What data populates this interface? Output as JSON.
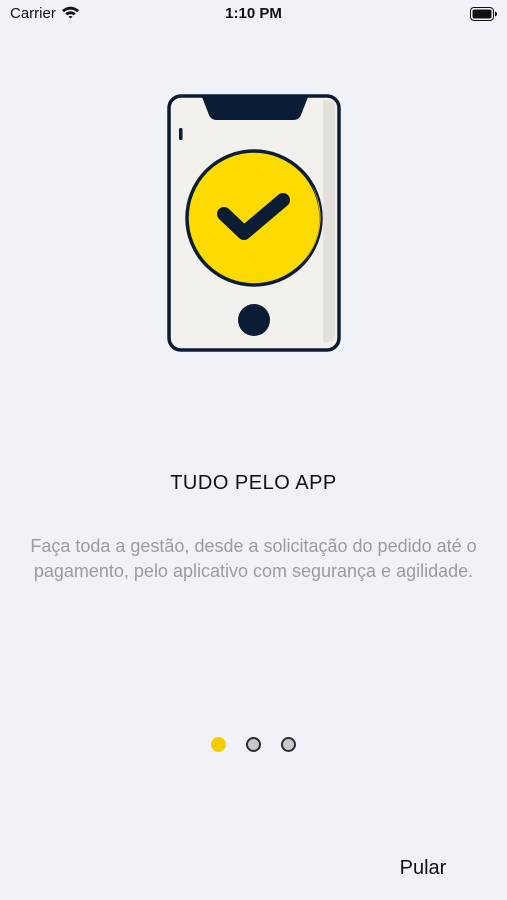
{
  "status_bar": {
    "carrier": "Carrier",
    "time": "1:10 PM",
    "wifi_icon": "wifi-icon",
    "battery_icon": "battery-icon"
  },
  "illustration": {
    "icon": "phone-checkmark-icon",
    "colors": {
      "outline": "#0b1c35",
      "screen": "#f3f1ee",
      "screen_shade": "#e4e0dc",
      "badge": "#fddb00",
      "badge_shade": "#e7bd00"
    }
  },
  "onboarding": {
    "title": "TUDO PELO APP",
    "description": "Faça toda a gestão, desde a solicitação do pedido até o pagamento, pelo aplicativo com segurança e agilidade."
  },
  "pagination": {
    "total_pages": 3,
    "current_page": 1,
    "active_color": "#f6cd02",
    "inactive_color": "#c8c8cc"
  },
  "footer": {
    "skip_label": "Pular"
  }
}
